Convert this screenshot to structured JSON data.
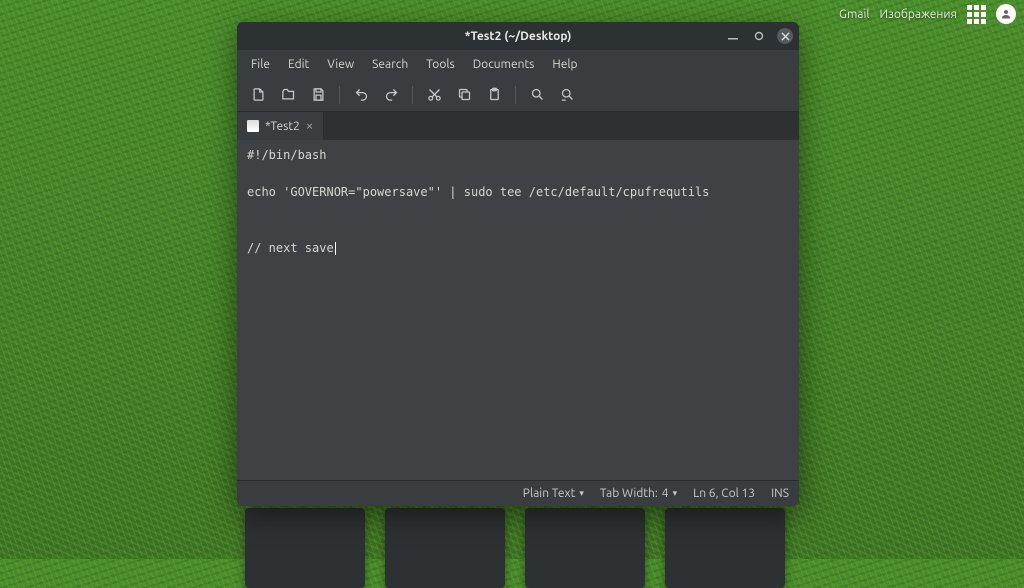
{
  "topbar": {
    "link1": "Gmail",
    "link2": "Изображения"
  },
  "window": {
    "title": "*Test2 (~/Desktop)"
  },
  "menu": {
    "file": "File",
    "edit": "Edit",
    "view": "View",
    "search": "Search",
    "tools": "Tools",
    "documents": "Documents",
    "help": "Help"
  },
  "tab": {
    "label": "*Test2",
    "close": "×"
  },
  "editor": {
    "content": "#!/bin/bash\n\necho 'GOVERNOR=\"powersave\"' | sudo tee /etc/default/cpufrequtils\n\n\n// next save"
  },
  "status": {
    "lang": "Plain Text",
    "tabwidth_label": "Tab Width:",
    "tabwidth_value": "4",
    "position": "Ln 6, Col 13",
    "mode": "INS"
  }
}
